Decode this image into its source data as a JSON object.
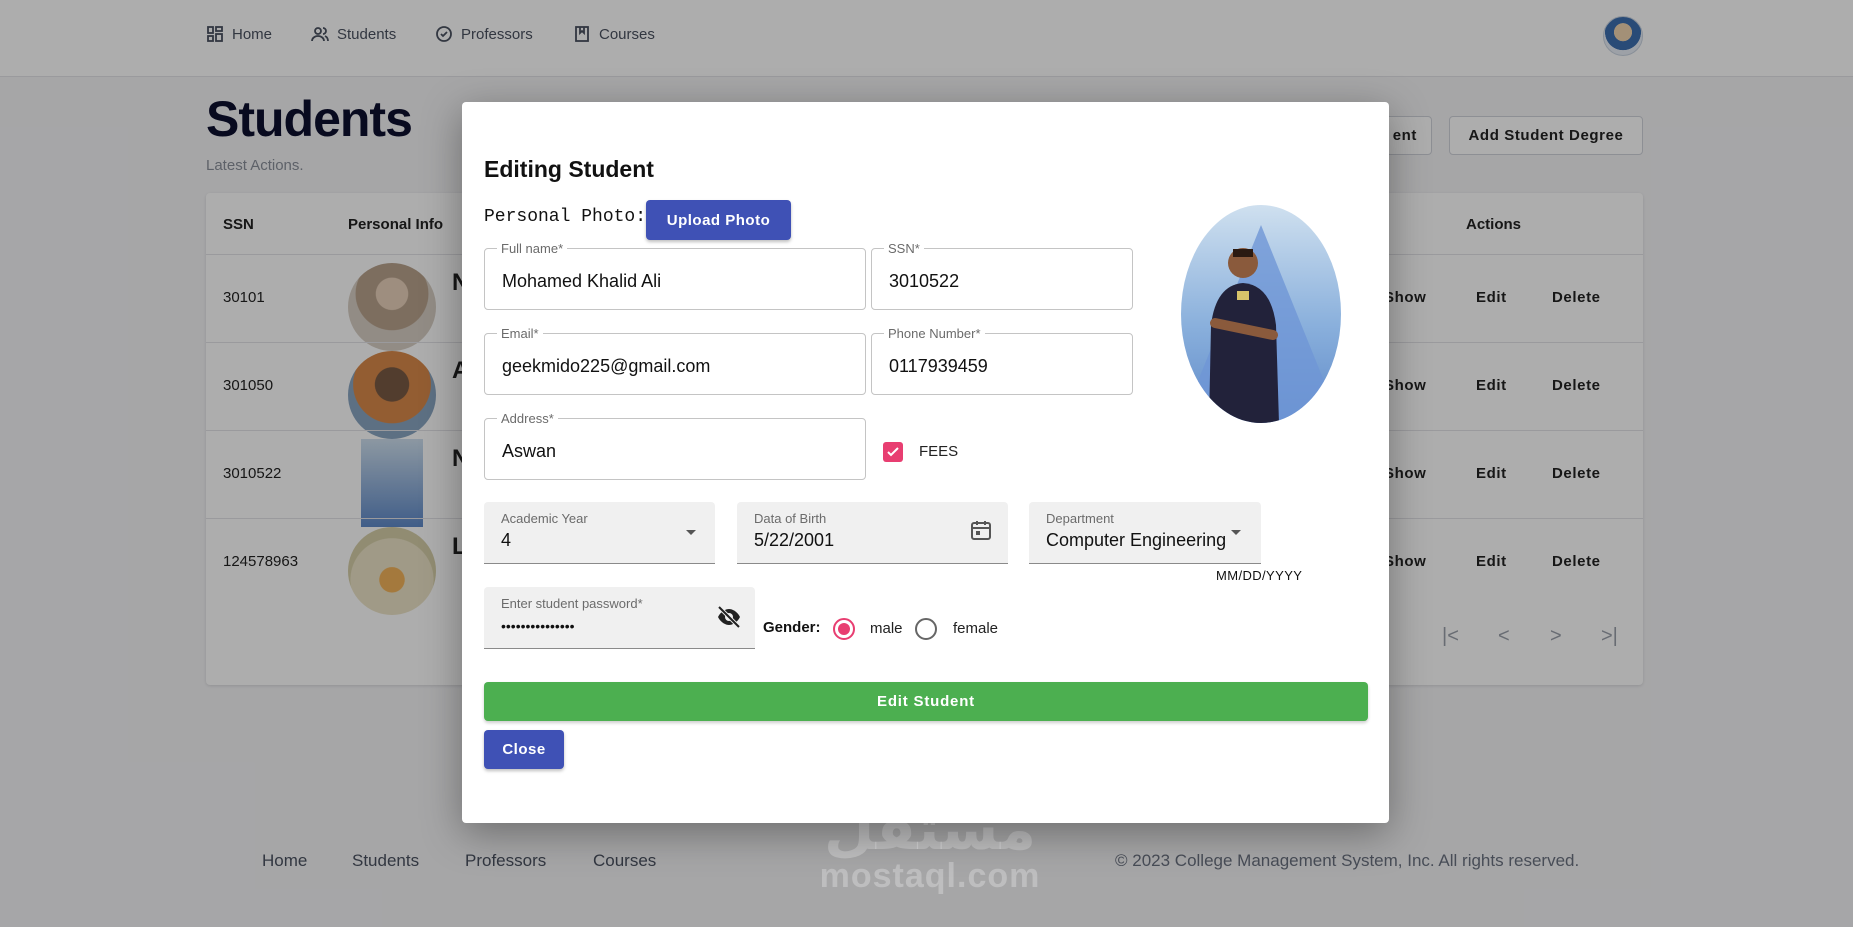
{
  "nav": {
    "items": [
      {
        "label": "Home",
        "icon": "grid-icon"
      },
      {
        "label": "Students",
        "icon": "users-icon"
      },
      {
        "label": "Professors",
        "icon": "check-circle-icon"
      },
      {
        "label": "Courses",
        "icon": "bookmark-icon"
      }
    ]
  },
  "page": {
    "title": "Students",
    "subtitle": "Latest Actions.",
    "buttons": {
      "add_student_partial": "ent",
      "add_degree": "Add Student Degree"
    }
  },
  "table": {
    "headers": {
      "ssn": "SSN",
      "personal_info": "Personal Info",
      "actions": "Actions"
    },
    "rows": [
      {
        "ssn": "30101",
        "initial": "N"
      },
      {
        "ssn": "301050",
        "initial": "A"
      },
      {
        "ssn": "3010522",
        "initial": "N"
      },
      {
        "ssn": "124578963",
        "initial": "L"
      }
    ],
    "actions": {
      "show": "Show",
      "edit": "Edit",
      "delete": "Delete"
    }
  },
  "modal": {
    "title": "Editing Student",
    "photo_label": "Personal Photo:",
    "upload_label": "Upload Photo",
    "fields": {
      "full_name": {
        "label": "Full name*",
        "value": "Mohamed Khalid Ali"
      },
      "ssn": {
        "label": "SSN*",
        "value": "3010522"
      },
      "email": {
        "label": "Email*",
        "value": "geekmido225@gmail.com"
      },
      "phone": {
        "label": "Phone Number*",
        "value": "0117939459"
      },
      "address": {
        "label": "Address*",
        "value": "Aswan"
      },
      "academic_year": {
        "label": "Academic Year",
        "value": "4"
      },
      "dob": {
        "label": "Data of Birth",
        "value": "5/22/2001",
        "helper": "MM/DD/YYYY"
      },
      "department": {
        "label": "Department",
        "value": "Computer Engineering"
      },
      "password": {
        "label": "Enter student password*",
        "value": "•••••••••••••••"
      }
    },
    "fees": {
      "label": "FEES",
      "checked": true
    },
    "gender": {
      "label": "Gender:",
      "options": [
        "male",
        "female"
      ],
      "selected": "male"
    },
    "edit_label": "Edit Student",
    "close_label": "Close"
  },
  "footer": {
    "links": [
      "Home",
      "Students",
      "Professors",
      "Courses"
    ],
    "copyright": "© 2023 College Management System, Inc. All rights reserved."
  },
  "watermark": {
    "arabic": "مستقل",
    "latin": "mostaql.com"
  },
  "colors": {
    "primary": "#3f51b5",
    "success": "#4caf50",
    "accent": "#e83e71"
  }
}
